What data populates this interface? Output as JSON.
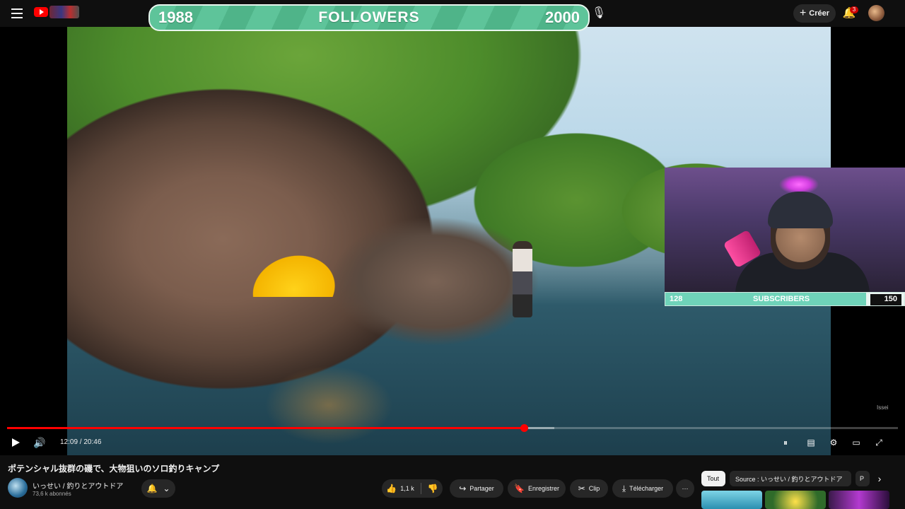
{
  "header": {
    "create_label": "Créer",
    "notif_count": "3",
    "icons": [
      "menu-icon",
      "youtube-logo",
      "mic-icon",
      "bell-icon",
      "avatar"
    ]
  },
  "followers_overlay": {
    "start": "1988",
    "label": "FOLLOWERS",
    "goal": "2000"
  },
  "subscribers_overlay": {
    "start": "128",
    "label": "SUBSCRIBERS",
    "goal": "150"
  },
  "player": {
    "time": "12:09 / 20:46",
    "progress_fraction": 0.58,
    "watermark": "Issei",
    "accent": "#ff0000"
  },
  "video": {
    "title": "ポテンシャル抜群の磯で、大物狙いのソロ釣りキャンプ",
    "channel": "いっせい / 釣りとアウトドア",
    "subscribers": "73,6 k abonnés"
  },
  "actions": {
    "likes": "1,1 k",
    "share": "Partager",
    "save": "Enregistrer",
    "clip": "Clip",
    "download": "Télécharger"
  },
  "chips": {
    "all": "Tout",
    "source": "Source : いっせい / 釣りとアウトドア",
    "partial": "P"
  }
}
